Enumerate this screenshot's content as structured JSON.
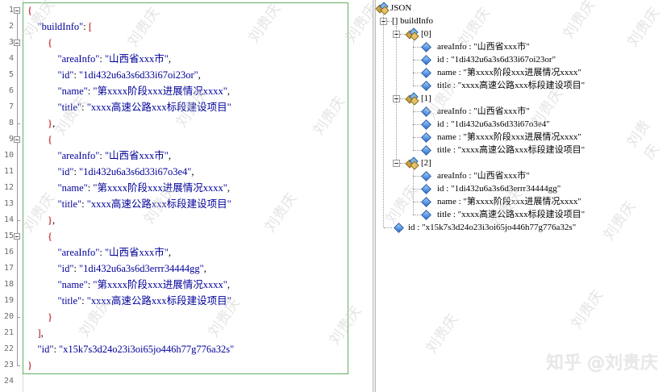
{
  "editor": {
    "lines": [
      {
        "n": "1",
        "text": "{"
      },
      {
        "n": "2",
        "text": "    \"buildInfo\": ["
      },
      {
        "n": "3",
        "text": "        {"
      },
      {
        "n": "4",
        "text": "            \"areaInfo\": \"山西省xxx市\","
      },
      {
        "n": "5",
        "text": "            \"id\": \"1di432u6a3s6d33i67oi23or\","
      },
      {
        "n": "6",
        "text": "            \"name\": \"第xxxx阶段xxx进展情况xxxx\","
      },
      {
        "n": "7",
        "text": "            \"title\": \"xxxx高速公路xxx标段建设项目\""
      },
      {
        "n": "8",
        "text": "        },"
      },
      {
        "n": "9",
        "text": "        {"
      },
      {
        "n": "10",
        "text": "            \"areaInfo\": \"山西省xxx市\","
      },
      {
        "n": "11",
        "text": "            \"id\": \"1di432u6a3s6d33i67o3e4\","
      },
      {
        "n": "12",
        "text": "            \"name\": \"第xxxx阶段xxx进展情况xxxx\","
      },
      {
        "n": "13",
        "text": "            \"title\": \"xxxx高速公路xxx标段建设项目\""
      },
      {
        "n": "14",
        "text": "        },"
      },
      {
        "n": "15",
        "text": "        {"
      },
      {
        "n": "16",
        "text": "            \"areaInfo\": \"山西省xxx市\","
      },
      {
        "n": "17",
        "text": "            \"id\": \"1di432u6a3s6d3errr34444gg\","
      },
      {
        "n": "18",
        "text": "            \"name\": \"第xxxx阶段xxx进展情况xxxx\","
      },
      {
        "n": "19",
        "text": "            \"title\": \"xxxx高速公路xxx标段建设项目\""
      },
      {
        "n": "20",
        "text": "        }"
      },
      {
        "n": "21",
        "text": "    ],"
      },
      {
        "n": "22",
        "text": "    \"id\": \"x15k7s3d24o23i3oi65jo446h77g776a32s\""
      },
      {
        "n": "23",
        "text": "}"
      },
      {
        "n": "24",
        "text": ""
      }
    ]
  },
  "tree": {
    "root_label": "JSON",
    "array_label": "[] buildInfo",
    "items": [
      {
        "label": "[0]",
        "fields": [
          "areaInfo : \"山西省xxx市\"",
          "id : \"1di432u6a3s6d33i67oi23or\"",
          "name : \"第xxxx阶段xxx进展情况xxxx\"",
          "title : \"xxxx高速公路xxx标段建设项目\""
        ]
      },
      {
        "label": "[1]",
        "fields": [
          "areaInfo : \"山西省xxx市\"",
          "id : \"1di432u6a3s6d33i67o3e4\"",
          "name : \"第xxxx阶段xxx进展情况xxxx\"",
          "title : \"xxxx高速公路xxx标段建设项目\""
        ]
      },
      {
        "label": "[2]",
        "fields": [
          "areaInfo : \"山西省xxx市\"",
          "id : \"1di432u6a3s6d3errr34444gg\"",
          "name : \"第xxxx阶段xxx进展情况xxxx\"",
          "title : \"xxxx高速公路xxx标段建设项目\""
        ]
      }
    ],
    "root_id": "id : \"x15k7s3d24o23i3oi65jo446h77g776a32s\""
  },
  "watermark": {
    "text": "知乎 @刘贵庆",
    "repeat_text": "刘贵庆"
  }
}
